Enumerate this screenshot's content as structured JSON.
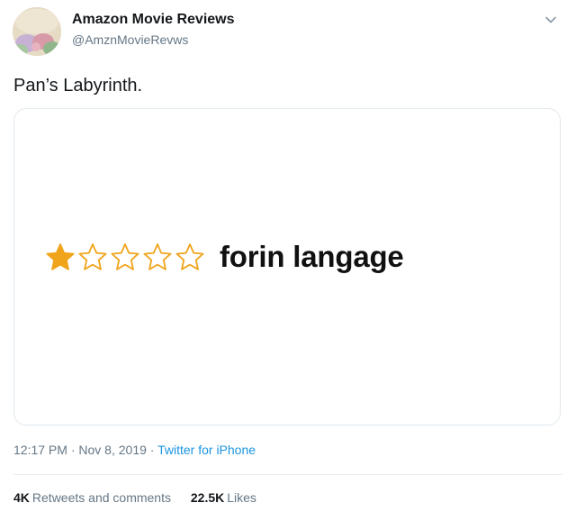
{
  "author": {
    "name": "Amazon Movie Reviews",
    "handle": "@AmznMovieRevws"
  },
  "icons": {
    "more": "chevron-down-icon",
    "star": "star-icon"
  },
  "tweet": {
    "text": "Pan’s Labyrinth."
  },
  "review": {
    "rating": 1,
    "max_rating": 5,
    "title": "forin langage",
    "star_color": "#f0a41b"
  },
  "meta": {
    "time": "12:17 PM",
    "separator": "·",
    "date": "Nov 8, 2019",
    "source": "Twitter for iPhone"
  },
  "stats": {
    "retweets_count": "4K",
    "retweets_label": "Retweets and comments",
    "likes_count": "22.5K",
    "likes_label": "Likes"
  }
}
